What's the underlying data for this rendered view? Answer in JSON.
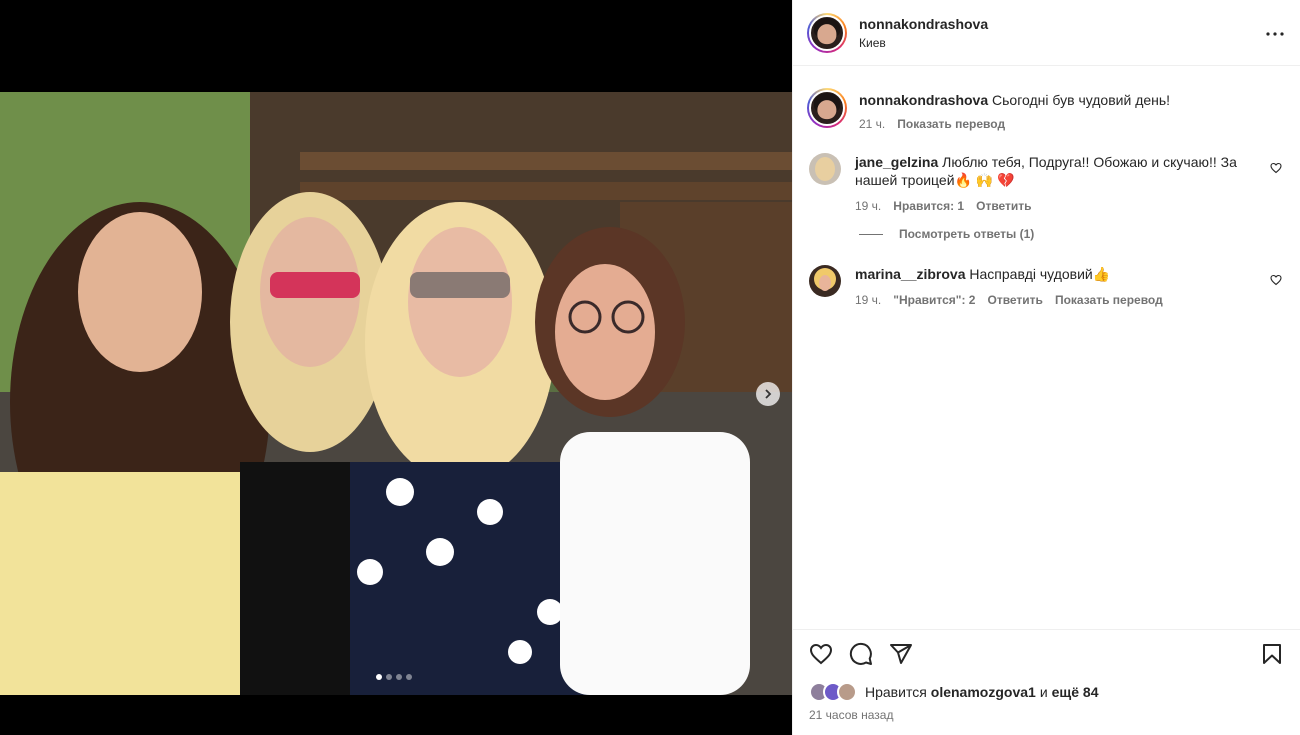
{
  "post": {
    "author": "nonnakondrashova",
    "location": "Киев",
    "more_icon": "more-horizontal-icon",
    "caption_author": "nonnakondrashova",
    "caption_text": "Сьогодні був чудовий день!",
    "caption_time": "21 ч.",
    "caption_translate": "Показать перевод",
    "carousel": {
      "total_slides": 4,
      "active_slide": 1,
      "next_icon": "chevron-right-icon"
    }
  },
  "comments": [
    {
      "username": "jane_gelzina",
      "text": "Люблю тебя, Подруга!! Обожаю и скучаю!! За нашей троицей🔥 🙌 💔",
      "time": "19 ч.",
      "likes": "Нравится: 1",
      "reply": "Ответить",
      "view_replies": "Посмотреть ответы (1)"
    },
    {
      "username": "marina__zibrova",
      "text": "Насправді чудовий👍",
      "time": "19 ч.",
      "likes": "\"Нравится\": 2",
      "reply": "Ответить",
      "translate": "Показать перевод"
    }
  ],
  "footer": {
    "likes_prefix": "Нравится",
    "likes_user": "olenamozgova1",
    "likes_and": "и",
    "likes_more": "ещё 84",
    "timestamp": "21 часов назад",
    "icons": [
      "heart-icon",
      "comment-icon",
      "share-icon",
      "bookmark-icon"
    ]
  }
}
